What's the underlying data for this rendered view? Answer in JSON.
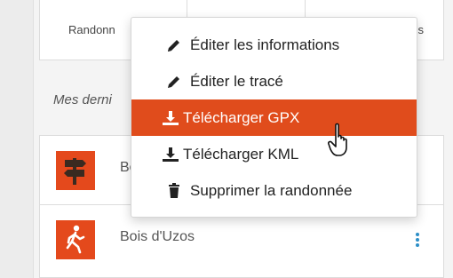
{
  "tabs": [
    "Randonn",
    "",
    "s"
  ],
  "section": {
    "title": "Mes derni"
  },
  "list": {
    "items": [
      {
        "name": "Bo",
        "thumb_icon": "signpost-icon"
      },
      {
        "name": "Bois d'Uzos",
        "thumb_icon": "hiker-icon"
      }
    ]
  },
  "menu": {
    "items": [
      {
        "label": "Éditer les informations",
        "icon": "pencil-icon"
      },
      {
        "label": "Éditer le tracé",
        "icon": "pencil-icon"
      },
      {
        "label": "Télécharger GPX",
        "icon": "download-icon",
        "active": true
      },
      {
        "label": "Télécharger KML",
        "icon": "download-icon"
      },
      {
        "label": "Supprimer la randonnée",
        "icon": "trash-icon"
      }
    ]
  },
  "colors": {
    "accent": "#e04c1c",
    "thumb": "#e4491c",
    "kebab": "#2d8fc7"
  }
}
